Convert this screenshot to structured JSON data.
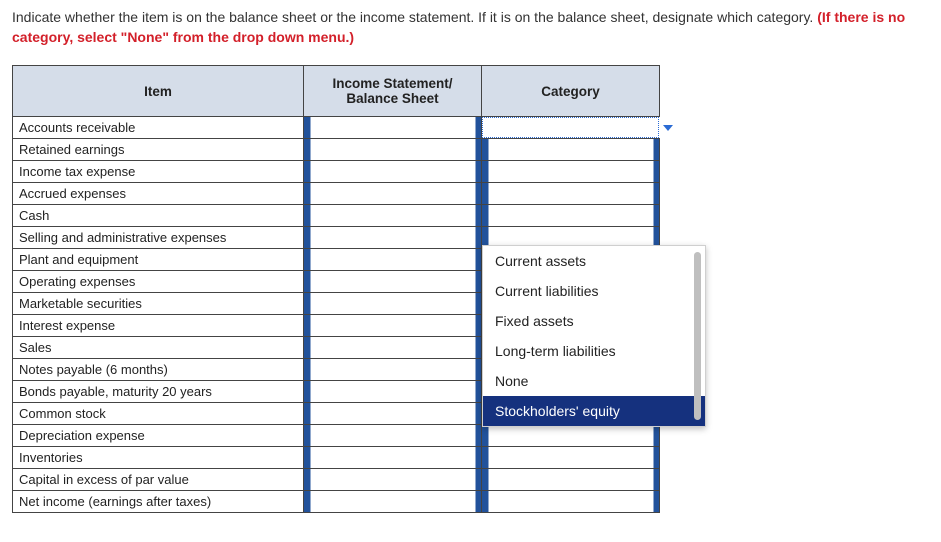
{
  "instruction": {
    "text": "Indicate whether the item is on the balance sheet or the income statement. If it is on the balance sheet, designate which category. ",
    "warn": "(If there is no category, select \"None\" from the drop down menu.)"
  },
  "headers": {
    "item": "Item",
    "statement": "Income Statement/ Balance Sheet",
    "category": "Category"
  },
  "items": [
    "Accounts receivable",
    "Retained earnings",
    "Income tax expense",
    "Accrued expenses",
    "Cash",
    "Selling and administrative expenses",
    "Plant and equipment",
    "Operating expenses",
    "Marketable securities",
    "Interest expense",
    "Sales",
    "Notes payable (6 months)",
    "Bonds payable, maturity 20 years",
    "Common stock",
    "Depreciation expense",
    "Inventories",
    "Capital in excess of par value",
    "Net income (earnings after taxes)"
  ],
  "dropdown_options": [
    {
      "label": "Current assets",
      "hl": false
    },
    {
      "label": "Current liabilities",
      "hl": false
    },
    {
      "label": "Fixed assets",
      "hl": false
    },
    {
      "label": "Long-term liabilities",
      "hl": false
    },
    {
      "label": "None",
      "hl": false
    },
    {
      "label": "Stockholders' equity",
      "hl": true
    }
  ],
  "active_row_index": 0
}
